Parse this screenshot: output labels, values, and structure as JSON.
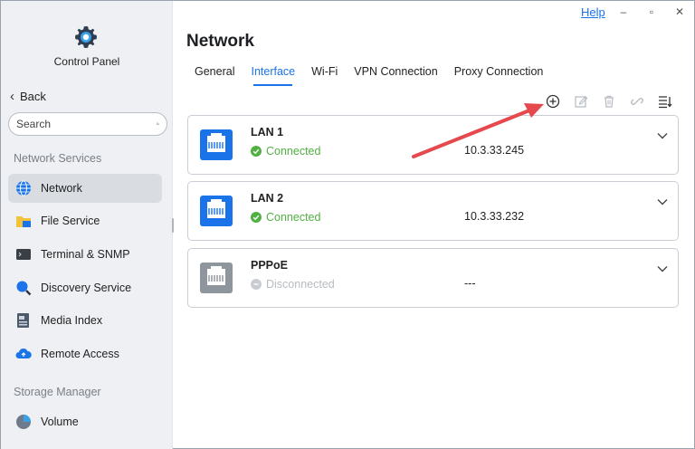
{
  "titlebar": {
    "help_label": "Help",
    "minimize_glyph": "–",
    "maximize_glyph": "▫",
    "close_glyph": "✕"
  },
  "sidebar": {
    "app_title": "Control Panel",
    "back_label": "Back",
    "search_placeholder": "Search",
    "section_network": "Network Services",
    "items": [
      {
        "label": "Network",
        "icon": "globe-icon",
        "active": true
      },
      {
        "label": "File Service",
        "icon": "folder-icon"
      },
      {
        "label": "Terminal & SNMP",
        "icon": "terminal-icon"
      },
      {
        "label": "Discovery Service",
        "icon": "magnifier-icon"
      },
      {
        "label": "Media Index",
        "icon": "media-index-icon"
      },
      {
        "label": "Remote Access",
        "icon": "cloud-icon"
      }
    ],
    "section_storage": "Storage Manager",
    "storage_items": [
      {
        "label": "Volume",
        "icon": "pie-icon"
      }
    ]
  },
  "main": {
    "title": "Network",
    "tabs": [
      {
        "label": "General"
      },
      {
        "label": "Interface",
        "active": true
      },
      {
        "label": "Wi-Fi"
      },
      {
        "label": "VPN Connection"
      },
      {
        "label": "Proxy Connection"
      }
    ],
    "toolbar": [
      "add-circle-icon",
      "edit-icon",
      "delete-icon",
      "link-icon",
      "sort-icon"
    ],
    "interfaces": [
      {
        "name": "LAN 1",
        "status": "Connected",
        "ip": "10.3.33.245",
        "connected": true
      },
      {
        "name": "LAN 2",
        "status": "Connected",
        "ip": "10.3.33.232",
        "connected": true
      },
      {
        "name": "PPPoE",
        "status": "Disconnected",
        "ip": "---",
        "connected": false
      }
    ]
  },
  "colors": {
    "accent": "#1a73e8",
    "connected": "#52b043",
    "disconnected": "#b7bcc2",
    "arrow": "#e5484d",
    "lan_icon": "#1a73e8",
    "pppoe_icon": "#8e959d"
  }
}
